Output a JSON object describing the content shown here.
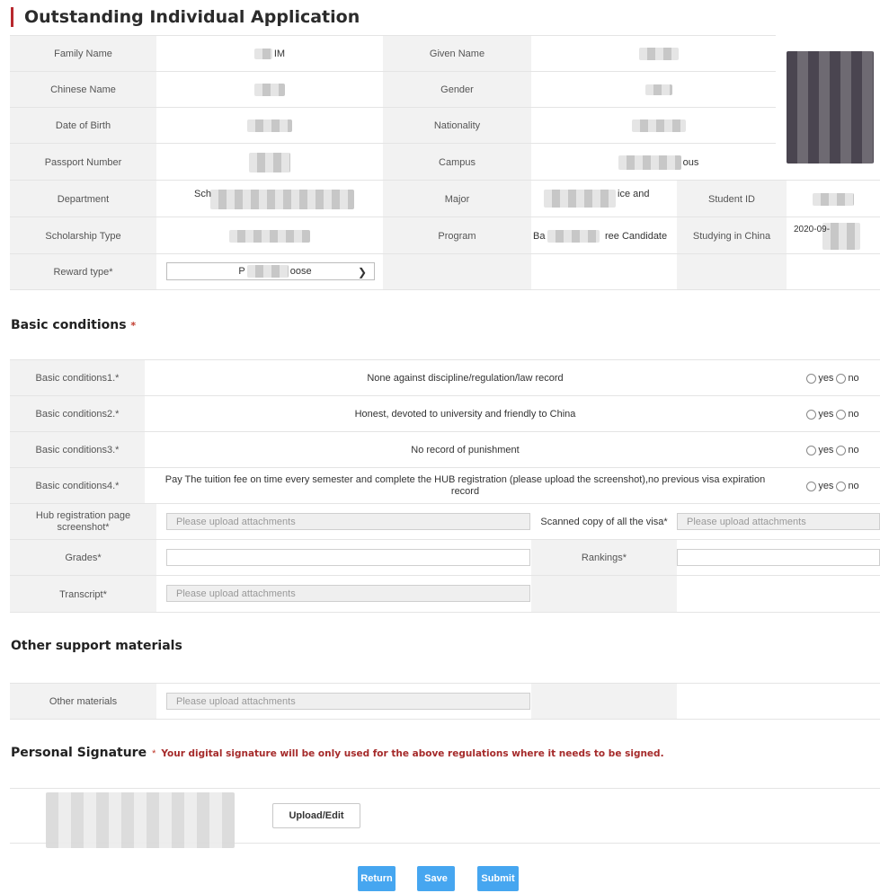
{
  "page_title": "Outstanding Individual Application",
  "profile": {
    "family_name_label": "Family Name",
    "family_name_value": "IM",
    "given_name_label": "Given Name",
    "chinese_name_label": "Chinese Name",
    "gender_label": "Gender",
    "dob_label": "Date of Birth",
    "nationality_label": "Nationality",
    "passport_label": "Passport Number",
    "campus_label": "Campus",
    "campus_value": "ous",
    "department_label": "Department",
    "department_value": "Sch",
    "major_label": "Major",
    "major_value": "ice and",
    "student_id_label": "Student ID",
    "scholarship_label": "Scholarship Type",
    "program_label": "Program",
    "program_value_a": "Ba",
    "program_value_b": "ree Candidate",
    "studying_label": "Studying in China",
    "studying_value": "2020-09-",
    "reward_label": "Reward type*",
    "reward_select_a": "P",
    "reward_select_b": "oose"
  },
  "basic": {
    "title": "Basic conditions",
    "req_mark": "*",
    "option_yes": "yes",
    "option_no": "no",
    "rows": [
      {
        "label": "Basic conditions1.*",
        "text": "None against discipline/regulation/law record"
      },
      {
        "label": "Basic conditions2.*",
        "text": "Honest, devoted to university and friendly to China"
      },
      {
        "label": "Basic conditions3.*",
        "text": "No record of punishment"
      },
      {
        "label": "Basic conditions4.*",
        "text": "Pay The tuition fee on time every semester and complete the HUB registration (please upload the screenshot),no previous visa expiration record"
      }
    ]
  },
  "uploads": {
    "hub_label": "Hub registration page screenshot*",
    "hub_placeholder": "Please upload attachments",
    "visa_label": "Scanned copy of all the visa*",
    "visa_placeholder": "Please upload attachments",
    "grades_label": "Grades*",
    "rankings_label": "Rankings*",
    "transcript_label": "Transcript*",
    "transcript_placeholder": "Please upload attachments"
  },
  "other": {
    "title": "Other support materials",
    "materials_label": "Other materials",
    "materials_placeholder": "Please upload attachments"
  },
  "signature": {
    "title": "Personal Signature",
    "req_mark": "*",
    "note": "Your digital signature will be only used for the above regulations where it needs to be signed.",
    "upload_label": "Upload/Edit"
  },
  "actions": {
    "return_label": "Return",
    "save_label": "Save",
    "submit_label": "Submit"
  },
  "colors": {
    "accent": "#b8282e",
    "button": "#46a6f0",
    "label_bg": "#f2f2f2"
  }
}
